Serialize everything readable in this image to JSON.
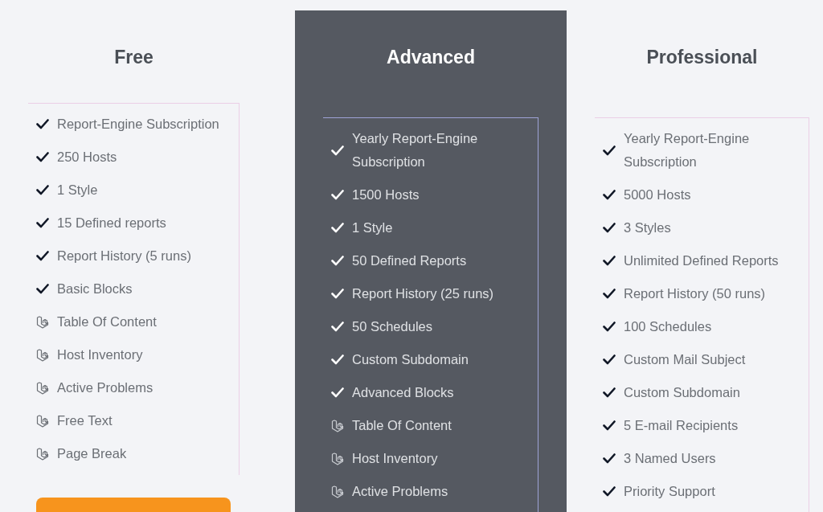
{
  "plans": [
    {
      "name": "Free",
      "highlighted": false,
      "features": [
        {
          "kind": "check",
          "text": "Report-Engine Subscription"
        },
        {
          "kind": "check",
          "text": "250 Hosts"
        },
        {
          "kind": "check",
          "text": "1 Style"
        },
        {
          "kind": "check",
          "text": "15 Defined reports"
        },
        {
          "kind": "check",
          "text": "Report History (5 runs)"
        },
        {
          "kind": "check",
          "text": "Basic Blocks"
        },
        {
          "kind": "block",
          "text": "Table Of Content"
        },
        {
          "kind": "block",
          "text": "Host Inventory"
        },
        {
          "kind": "block",
          "text": "Active Problems"
        },
        {
          "kind": "block",
          "text": "Free Text"
        },
        {
          "kind": "block",
          "text": "Page Break"
        }
      ],
      "button": true
    },
    {
      "name": "Advanced",
      "highlighted": true,
      "features": [
        {
          "kind": "check",
          "text": "Yearly Report-Engine Subscription"
        },
        {
          "kind": "check",
          "text": "1500 Hosts"
        },
        {
          "kind": "check",
          "text": "1 Style"
        },
        {
          "kind": "check",
          "text": "50 Defined Reports"
        },
        {
          "kind": "check",
          "text": "Report History (25 runs)"
        },
        {
          "kind": "check",
          "text": "50 Schedules"
        },
        {
          "kind": "check",
          "text": "Custom Subdomain"
        },
        {
          "kind": "check",
          "text": "Advanced Blocks"
        },
        {
          "kind": "block",
          "text": "Table Of Content"
        },
        {
          "kind": "block",
          "text": "Host Inventory"
        },
        {
          "kind": "block",
          "text": "Active Problems"
        }
      ]
    },
    {
      "name": "Professional",
      "highlighted": false,
      "features": [
        {
          "kind": "check",
          "text": "Yearly Report-Engine Subscription"
        },
        {
          "kind": "check",
          "text": "5000 Hosts"
        },
        {
          "kind": "check",
          "text": "3 Styles"
        },
        {
          "kind": "check",
          "text": "Unlimited Defined Reports"
        },
        {
          "kind": "check",
          "text": "Report History (50 runs)"
        },
        {
          "kind": "check",
          "text": "100 Schedules"
        },
        {
          "kind": "check",
          "text": "Custom Mail Subject"
        },
        {
          "kind": "check",
          "text": "Custom Subdomain"
        },
        {
          "kind": "check",
          "text": "5 E-mail Recipients"
        },
        {
          "kind": "check",
          "text": "3 Named Users"
        },
        {
          "kind": "check",
          "text": "Priority Support"
        }
      ]
    }
  ]
}
